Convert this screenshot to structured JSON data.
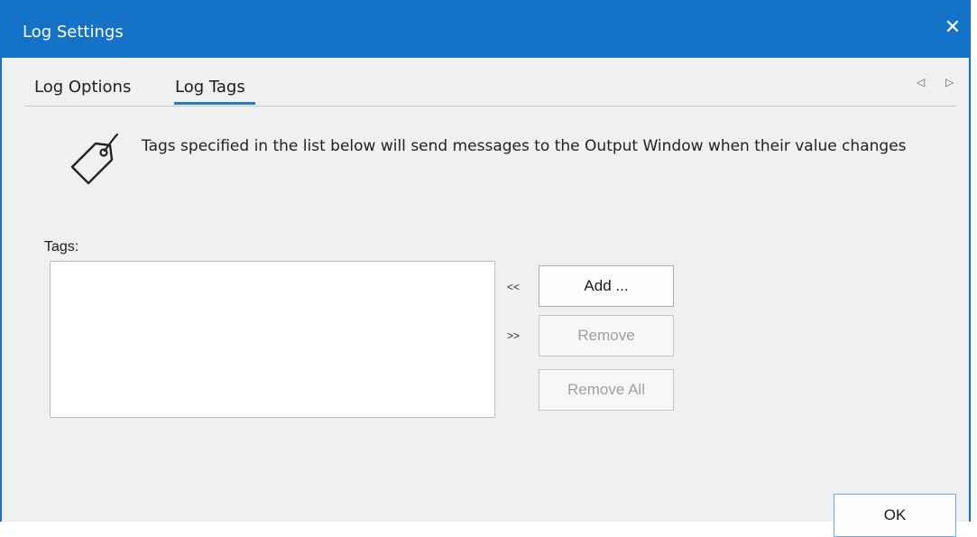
{
  "window": {
    "title": "Log Settings",
    "close_glyph": "✕"
  },
  "tabs": [
    {
      "label": "Log Options",
      "active": false
    },
    {
      "label": "Log Tags",
      "active": true
    }
  ],
  "tab_scroll": {
    "left_glyph": "◁",
    "right_glyph": "▷"
  },
  "info": {
    "icon": "tag-icon",
    "text": "Tags specified in the list below will send messages to the Output Window when their value changes"
  },
  "tags": {
    "label": "Tags:",
    "items": []
  },
  "actions": {
    "add_arrow": "<<",
    "remove_arrow": ">>",
    "add_label": "Add ...",
    "remove_label": "Remove",
    "remove_all_label": "Remove All"
  },
  "footer": {
    "ok_label": "OK"
  },
  "colors": {
    "accent": "#1473c8",
    "background": "#f0f0f0"
  }
}
